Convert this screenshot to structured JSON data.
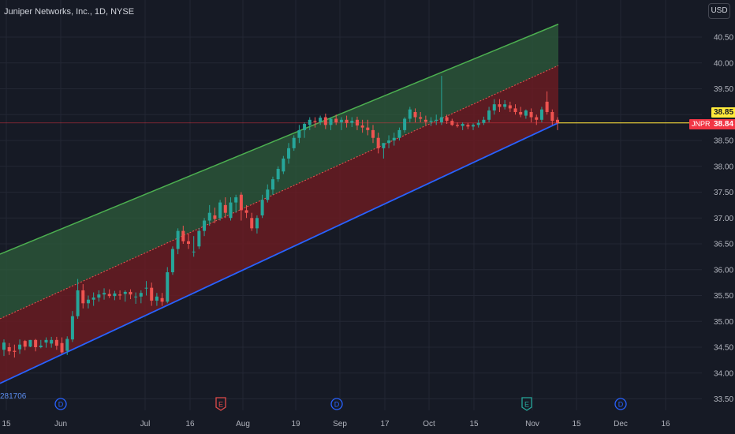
{
  "header": {
    "title": "Juniper Networks, Inc., 1D, NYSE",
    "currency_button": "USD"
  },
  "price_tags": {
    "last_price": "38.85",
    "ticker": "JNPR",
    "ticker_price": "38.84"
  },
  "partial_label": "281706",
  "y_axis_ticks": [
    "40.50",
    "40.00",
    "39.50",
    "39.00",
    "38.50",
    "38.00",
    "37.50",
    "37.00",
    "36.50",
    "36.00",
    "35.50",
    "35.00",
    "34.50",
    "34.00",
    "33.50"
  ],
  "x_axis_ticks": [
    "15",
    "Jun",
    "Jul",
    "16",
    "Aug",
    "19",
    "Sep",
    "17",
    "Oct",
    "15",
    "Nov",
    "15",
    "Dec",
    "16"
  ],
  "event_markers": [
    {
      "letter": "D",
      "type": "dividend",
      "near": "Jun"
    },
    {
      "letter": "E",
      "type": "earnings",
      "near": "Jul 16-Aug"
    },
    {
      "letter": "D",
      "type": "dividend",
      "near": "Sep"
    },
    {
      "letter": "E",
      "type": "earnings",
      "near": "Nov"
    },
    {
      "letter": "D",
      "type": "dividend",
      "near": "Dec"
    }
  ],
  "colors": {
    "background": "#161a25",
    "grid": "#232734",
    "axis_text": "#b2b5be",
    "up": "#26a69a",
    "down": "#ef5350",
    "upper_line": "#4caf50",
    "lower_line": "#2962ff",
    "mid_line": "#ef5350",
    "upper_fill": "#2e5c3b",
    "lower_fill": "#6e1c22",
    "price_line": "#ffeb3b",
    "dividend": "#2962ff",
    "earnings": "#e04a4a",
    "earnings_up": "#26a69a"
  },
  "chart_data": {
    "type": "candlestick",
    "symbol": "JNPR",
    "interval": "1D",
    "ylim": [
      33.5,
      40.6
    ],
    "last_price": 38.84,
    "candles": [
      [
        34.45,
        34.65,
        34.33,
        34.59
      ],
      [
        34.5,
        34.58,
        34.35,
        34.42
      ],
      [
        34.43,
        34.55,
        34.3,
        34.41
      ],
      [
        34.46,
        34.65,
        34.37,
        34.55
      ],
      [
        34.62,
        34.64,
        34.44,
        34.51
      ],
      [
        34.51,
        34.64,
        34.5,
        34.64
      ],
      [
        34.64,
        34.66,
        34.42,
        34.5
      ],
      [
        34.5,
        34.64,
        34.48,
        34.53
      ],
      [
        34.59,
        34.69,
        34.49,
        34.64
      ],
      [
        34.57,
        34.7,
        34.49,
        34.64
      ],
      [
        34.64,
        34.7,
        34.45,
        34.53
      ],
      [
        34.58,
        34.69,
        34.37,
        34.4
      ],
      [
        34.43,
        34.71,
        34.35,
        34.66
      ],
      [
        34.65,
        35.2,
        34.6,
        35.1
      ],
      [
        35.1,
        35.82,
        35.05,
        35.6
      ],
      [
        35.6,
        35.72,
        35.25,
        35.35
      ],
      [
        35.35,
        35.5,
        35.25,
        35.42
      ],
      [
        35.42,
        35.56,
        35.3,
        35.46
      ],
      [
        35.46,
        35.6,
        35.38,
        35.52
      ],
      [
        35.52,
        35.64,
        35.42,
        35.55
      ],
      [
        35.53,
        35.62,
        35.45,
        35.49
      ],
      [
        35.49,
        35.59,
        35.41,
        35.54
      ],
      [
        35.52,
        35.6,
        35.42,
        35.5
      ],
      [
        35.53,
        35.6,
        35.38,
        35.57
      ],
      [
        35.57,
        35.62,
        35.43,
        35.52
      ],
      [
        35.48,
        35.56,
        35.34,
        35.48
      ],
      [
        35.48,
        35.6,
        35.35,
        35.55
      ],
      [
        35.65,
        35.78,
        35.5,
        35.65
      ],
      [
        35.65,
        35.75,
        35.3,
        35.4
      ],
      [
        35.4,
        35.55,
        35.3,
        35.48
      ],
      [
        35.45,
        35.55,
        35.3,
        35.38
      ],
      [
        35.38,
        36.05,
        35.35,
        35.95
      ],
      [
        35.95,
        36.45,
        35.9,
        36.4
      ],
      [
        36.4,
        36.8,
        36.3,
        36.75
      ],
      [
        36.75,
        36.85,
        36.5,
        36.55
      ],
      [
        36.55,
        36.7,
        36.4,
        36.5
      ],
      [
        36.35,
        36.65,
        36.25,
        36.35
      ],
      [
        36.45,
        36.8,
        36.4,
        36.75
      ],
      [
        36.75,
        37.0,
        36.65,
        36.95
      ],
      [
        36.95,
        37.25,
        36.85,
        37.1
      ],
      [
        37.05,
        37.2,
        36.9,
        36.98
      ],
      [
        37.0,
        37.35,
        36.95,
        37.3
      ],
      [
        37.25,
        37.4,
        37.0,
        37.1
      ],
      [
        37.0,
        37.4,
        36.95,
        37.3
      ],
      [
        37.3,
        37.45,
        37.1,
        37.4
      ],
      [
        37.45,
        37.5,
        36.95,
        37.15
      ],
      [
        37.15,
        37.25,
        37.0,
        37.1
      ],
      [
        37.0,
        37.1,
        36.75,
        36.8
      ],
      [
        36.8,
        37.05,
        36.7,
        37.0
      ],
      [
        37.05,
        37.45,
        37.0,
        37.35
      ],
      [
        37.35,
        37.65,
        37.3,
        37.55
      ],
      [
        37.55,
        37.8,
        37.45,
        37.75
      ],
      [
        37.75,
        38.0,
        37.7,
        37.95
      ],
      [
        37.9,
        38.2,
        37.85,
        38.15
      ],
      [
        38.15,
        38.45,
        38.05,
        38.35
      ],
      [
        38.35,
        38.6,
        38.3,
        38.55
      ],
      [
        38.55,
        38.8,
        38.45,
        38.7
      ],
      [
        38.7,
        38.85,
        38.55,
        38.82
      ],
      [
        38.8,
        38.95,
        38.7,
        38.9
      ],
      [
        38.88,
        38.95,
        38.75,
        38.86
      ],
      [
        38.86,
        38.98,
        38.8,
        38.94
      ],
      [
        38.95,
        39.02,
        38.72,
        38.8
      ],
      [
        38.8,
        38.95,
        38.7,
        38.92
      ],
      [
        38.92,
        39.0,
        38.8,
        38.85
      ],
      [
        38.85,
        38.95,
        38.7,
        38.9
      ],
      [
        38.9,
        38.98,
        38.75,
        38.84
      ],
      [
        38.84,
        38.95,
        38.76,
        38.88
      ],
      [
        38.9,
        38.96,
        38.7,
        38.79
      ],
      [
        38.79,
        38.9,
        38.65,
        38.75
      ],
      [
        38.75,
        38.9,
        38.6,
        38.7
      ],
      [
        38.7,
        38.8,
        38.45,
        38.55
      ],
      [
        38.55,
        38.65,
        38.25,
        38.35
      ],
      [
        38.35,
        38.45,
        38.15,
        38.45
      ],
      [
        38.45,
        38.6,
        38.35,
        38.5
      ],
      [
        38.5,
        38.65,
        38.4,
        38.55
      ],
      [
        38.55,
        38.75,
        38.5,
        38.7
      ],
      [
        38.7,
        38.95,
        38.65,
        38.92
      ],
      [
        38.92,
        39.15,
        38.85,
        39.1
      ],
      [
        39.05,
        39.12,
        38.85,
        38.95
      ],
      [
        38.95,
        39.05,
        38.85,
        38.92
      ],
      [
        38.9,
        38.98,
        38.8,
        38.86
      ],
      [
        38.86,
        38.95,
        38.78,
        38.88
      ],
      [
        38.88,
        39.0,
        38.8,
        38.9
      ],
      [
        38.85,
        39.75,
        38.8,
        38.95
      ],
      [
        38.95,
        39.0,
        38.82,
        38.88
      ],
      [
        38.88,
        38.92,
        38.78,
        38.8
      ],
      [
        38.8,
        38.85,
        38.75,
        38.78
      ],
      [
        38.78,
        38.85,
        38.7,
        38.82
      ],
      [
        38.8,
        38.84,
        38.72,
        38.77
      ],
      [
        38.77,
        38.83,
        38.7,
        38.8
      ],
      [
        38.8,
        38.9,
        38.75,
        38.84
      ],
      [
        38.84,
        38.96,
        38.8,
        38.9
      ],
      [
        38.9,
        39.15,
        38.85,
        39.08
      ],
      [
        39.08,
        39.3,
        39.0,
        39.2
      ],
      [
        39.2,
        39.3,
        39.05,
        39.15
      ],
      [
        39.15,
        39.28,
        39.1,
        39.2
      ],
      [
        39.18,
        39.25,
        39.05,
        39.12
      ],
      [
        39.12,
        39.2,
        39.0,
        39.05
      ],
      [
        39.05,
        39.15,
        38.95,
        39.0
      ],
      [
        38.98,
        39.1,
        38.92,
        39.08
      ],
      [
        39.05,
        39.12,
        38.85,
        38.95
      ],
      [
        38.95,
        39.0,
        38.8,
        38.9
      ],
      [
        38.9,
        39.15,
        38.85,
        39.1
      ],
      [
        39.25,
        39.45,
        39.0,
        39.05
      ],
      [
        39.05,
        39.1,
        38.8,
        38.88
      ],
      [
        38.9,
        38.95,
        38.7,
        38.84
      ]
    ],
    "upper_line": [
      36.3,
      40.75
    ],
    "mid_line": [
      35.05,
      39.95
    ],
    "lower_line": [
      33.8,
      38.84
    ]
  }
}
